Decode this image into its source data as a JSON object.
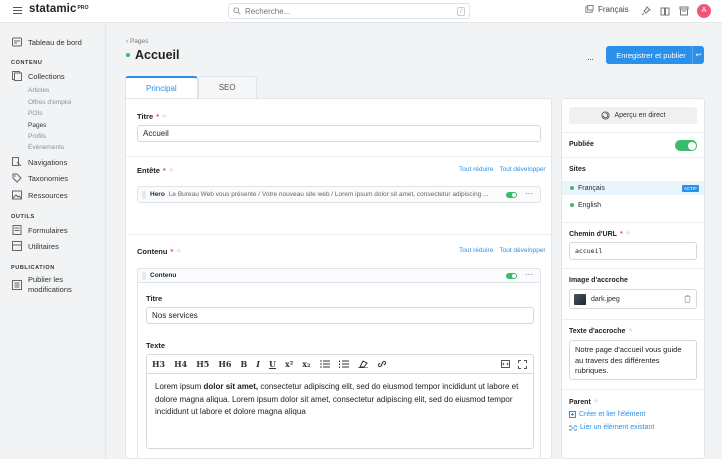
{
  "topbar": {
    "logo": "statamic",
    "logo_badge": "PRO",
    "search_placeholder": "Recherche...",
    "search_shortcut": "/",
    "language": "Français",
    "avatar_initial": "A",
    "colors": {
      "accent": "#2b90e9",
      "avatar": "#f0567a"
    }
  },
  "sidebar": {
    "dashboard": "Tableau de bord",
    "section_content": "CONTENU",
    "collections": "Collections",
    "collection_items": [
      "Articles",
      "Offres d'emploi",
      "POIs",
      "Pages",
      "Profils",
      "Événements"
    ],
    "navigations": "Navigations",
    "taxonomies": "Taxonomies",
    "resources": "Ressources",
    "section_tools": "OUTILS",
    "forms": "Formulaires",
    "utilities": "Utilitaires",
    "section_publication": "PUBLICATION",
    "publish_line1": "Publier les",
    "publish_line2": "modifications"
  },
  "header": {
    "breadcrumb": "‹ Pages",
    "title": "Accueil",
    "more": "···",
    "save_label": "Enregistrer et publier",
    "save_arrow": "↩"
  },
  "tabs": [
    "Principal",
    "SEO"
  ],
  "form": {
    "title_label": "Titre",
    "title_value": "Accueil",
    "header_label": "Entête",
    "collapse_all": "Tout réduire",
    "expand_all": "Tout développer",
    "hero_name": "Hero",
    "hero_preview": "Le Bureau Web vous présente / Votre nouveau site web / Lorem ipsum dolor sit amet, consectetur adipiscing ...",
    "content_label": "Contenu",
    "content_set_name": "Contenu",
    "inner_title_label": "Titre",
    "inner_title_value": "Nos services",
    "text_label": "Texte",
    "toolbar_items": [
      "H3",
      "H4",
      "H5",
      "H6",
      "B",
      "I",
      "U",
      "x²",
      "x₂"
    ],
    "text_bold_prefix": "Lorem ipsum ",
    "text_bold": "dolor sit amet,",
    "text_rest": " consectetur adipiscing elit, sed do eiusmod tempor incididunt ut labore et dolore magna aliqua. Lorem ipsum dolor sit amet, consectetur adipiscing elit, sed do eiusmod tempor incididunt ut labore et dolore magna aliqua"
  },
  "right": {
    "preview_label": "Aperçu en direct",
    "published_label": "Publiée",
    "sites_label": "Sites",
    "site_1": "Français",
    "site_1_badge": "ACTIF",
    "site_2": "English",
    "slug_label": "Chemin d'URL",
    "slug_value": "accueil",
    "image_label": "Image d'accroche",
    "image_file": "dark.jpeg",
    "teaser_label": "Texte d'accroche",
    "teaser_value": "Notre page d'accueil vous guide au travers des différentes rubriques.",
    "parent_label": "Parent",
    "parent_create": "Créer et lier l'élément",
    "parent_link": "Lier un élément existant"
  }
}
